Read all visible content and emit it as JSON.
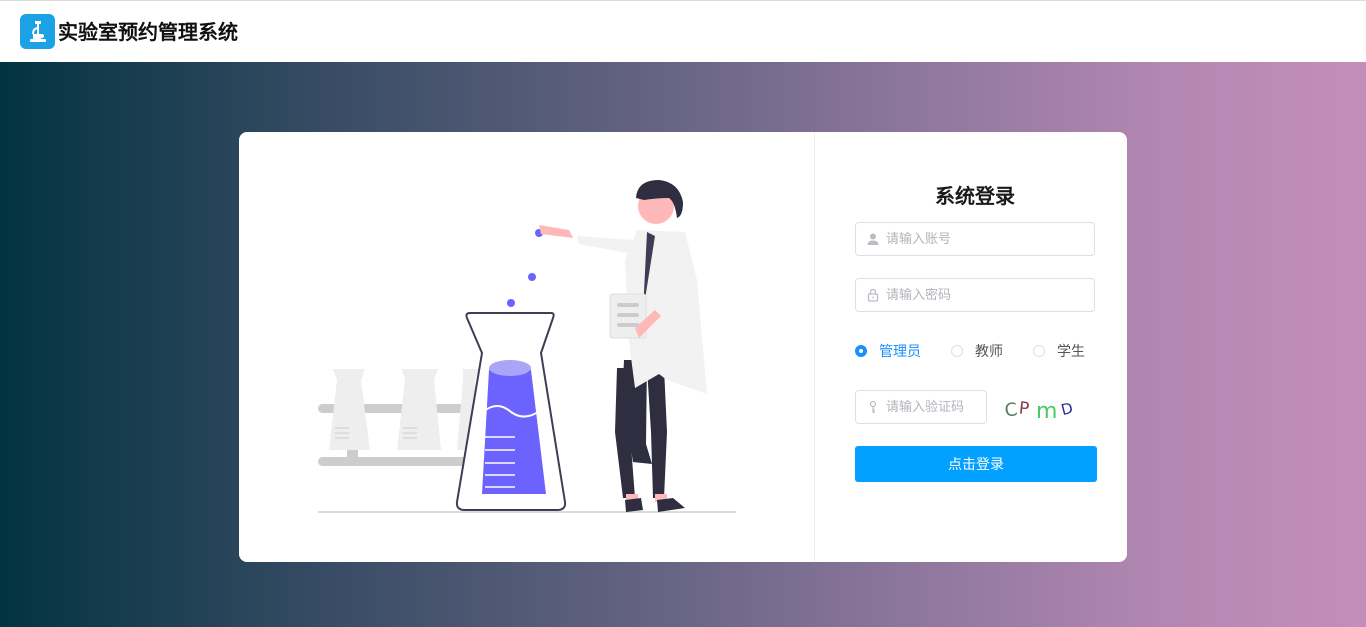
{
  "app": {
    "title": "实验室预约管理系统",
    "logo_icon": "microscope-icon",
    "brand_color": "#1aa1e6"
  },
  "background": {
    "gradient_start": "#023340",
    "gradient_end": "#c48eba"
  },
  "login": {
    "title": "系统登录",
    "username_placeholder": "请输入账号",
    "password_placeholder": "请输入密码",
    "captcha_placeholder": "请输入验证码",
    "captcha_text": "CPmD",
    "roles": [
      {
        "label": "管理员",
        "selected": true
      },
      {
        "label": "教师",
        "selected": false
      },
      {
        "label": "学生",
        "selected": false
      }
    ],
    "submit_label": "点击登录",
    "accent_color": "#03a1ff"
  },
  "illustration": {
    "subject": "scientist-with-flask",
    "flask_color": "#6c63ff"
  }
}
